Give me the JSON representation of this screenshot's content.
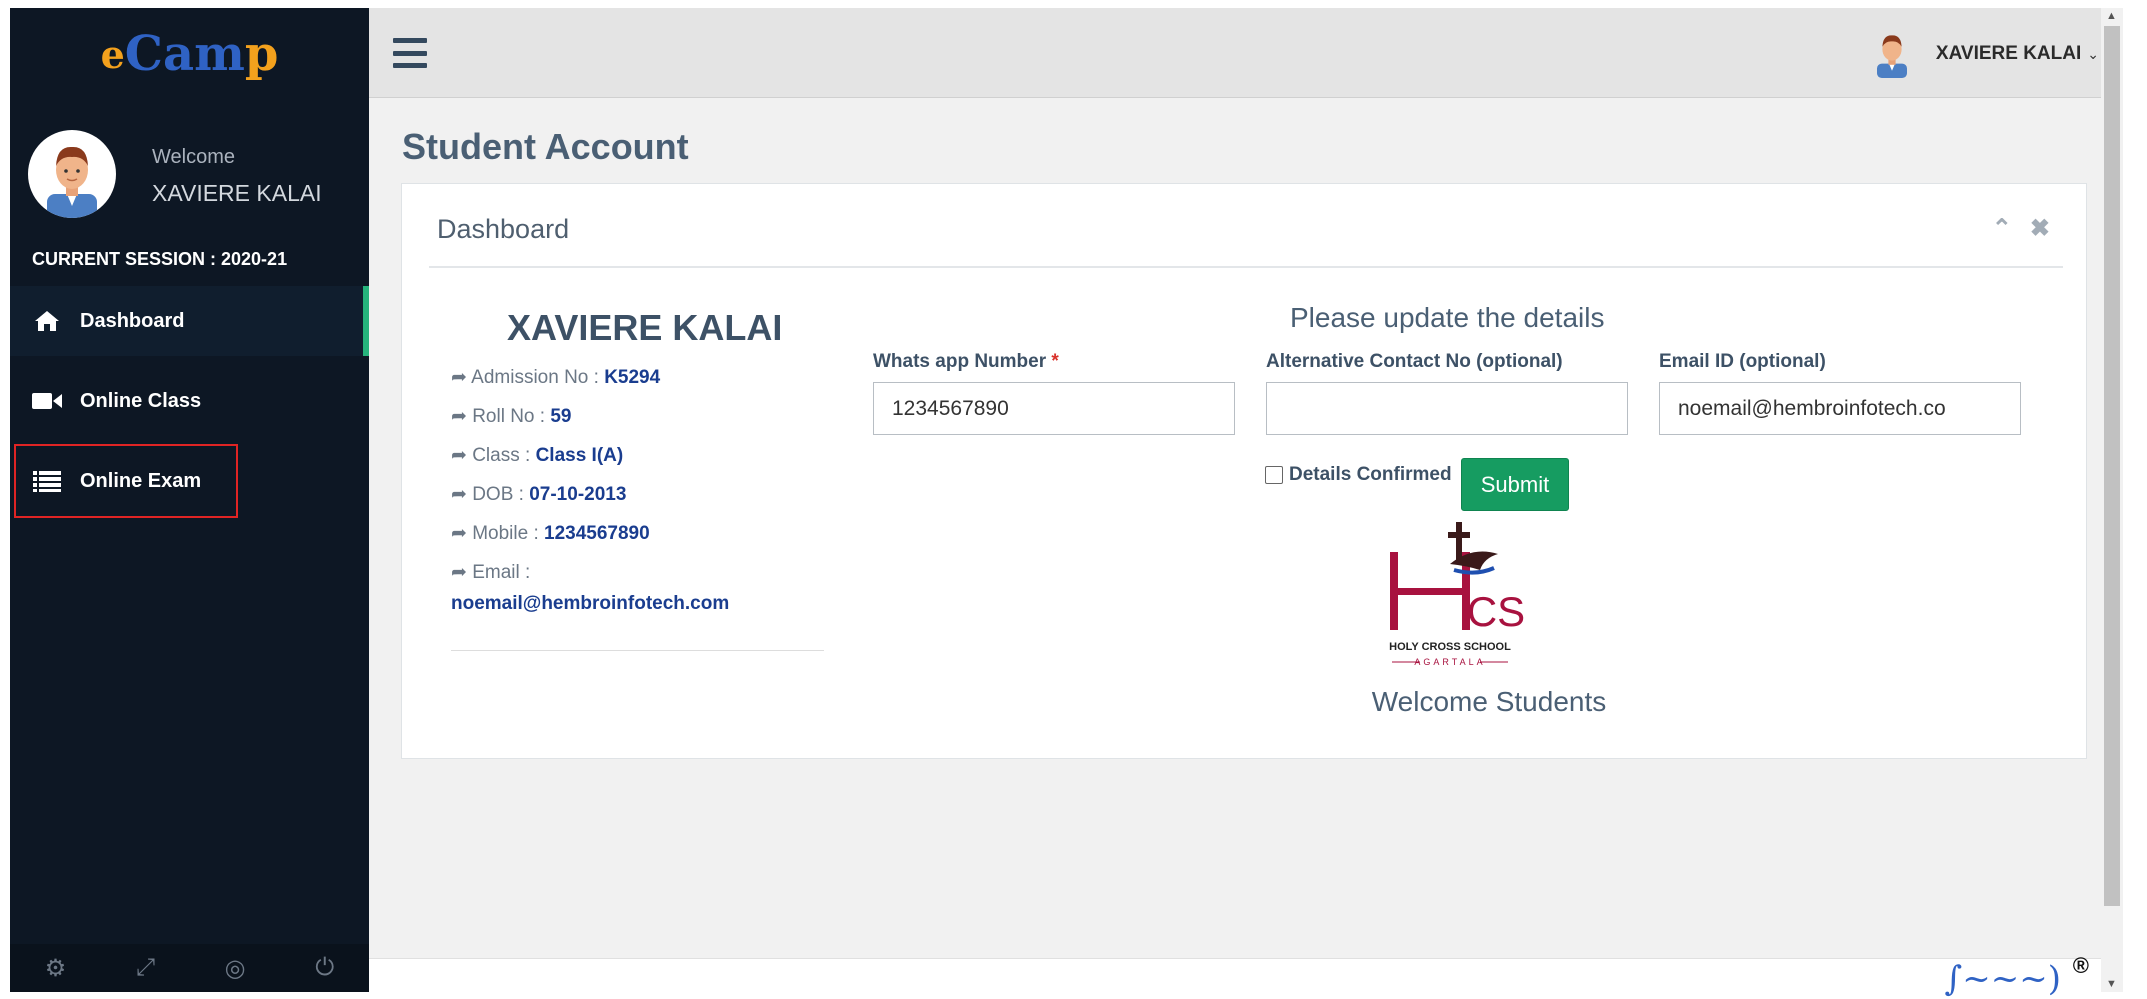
{
  "sidebar": {
    "logo": {
      "part1": "e",
      "part2": "Cam",
      "part3": "p"
    },
    "welcome_label": "Welcome",
    "user_name": "XAVIERE KALAI",
    "session_label": "CURRENT SESSION : 2020-21",
    "items": [
      {
        "label": "Dashboard",
        "icon": "home-icon",
        "active": true
      },
      {
        "label": "Online Class",
        "icon": "video-icon",
        "active": false
      },
      {
        "label": "Online Exam",
        "icon": "list-icon",
        "active": false
      }
    ],
    "footer_icons": [
      "gear-icon",
      "fullscreen-icon",
      "eye-slash-icon",
      "power-icon"
    ]
  },
  "topbar": {
    "user_name": "XAVIERE KALAI"
  },
  "main": {
    "page_title": "Student Account",
    "panel_title": "Dashboard",
    "student": {
      "name": "XAVIERE KALAI",
      "admission_label": "Admission No : ",
      "admission_value": "K5294",
      "roll_label": "Roll No : ",
      "roll_value": "59",
      "class_label": "Class : ",
      "class_value": "Class I(A)",
      "dob_label": "DOB : ",
      "dob_value": "07-10-2013",
      "mobile_label": "Mobile : ",
      "mobile_value": "1234567890",
      "email_label": "Email :",
      "email_value": "noemail@hembroinfotech.com"
    },
    "form": {
      "title": "Please update the details",
      "whatsapp_label": "Whats app Number",
      "whatsapp_required": "*",
      "whatsapp_value": "1234567890",
      "alt_contact_label": "Alternative Contact No (optional)",
      "alt_contact_value": "",
      "email_label": "Email ID (optional)",
      "email_value": "noemail@hembroinfotech.co",
      "confirm_label": "Details Confirmed",
      "submit_label": "Submit"
    },
    "school": {
      "name": "HOLY CROSS SCHOOL",
      "city": "AGARTALA",
      "initials": "HCS"
    },
    "welcome_message": "Welcome Students"
  },
  "colors": {
    "sidebar_bg": "#0d1724",
    "accent_green": "#26b47c",
    "submit_green": "#169c61",
    "value_blue": "#1a3d8f"
  }
}
